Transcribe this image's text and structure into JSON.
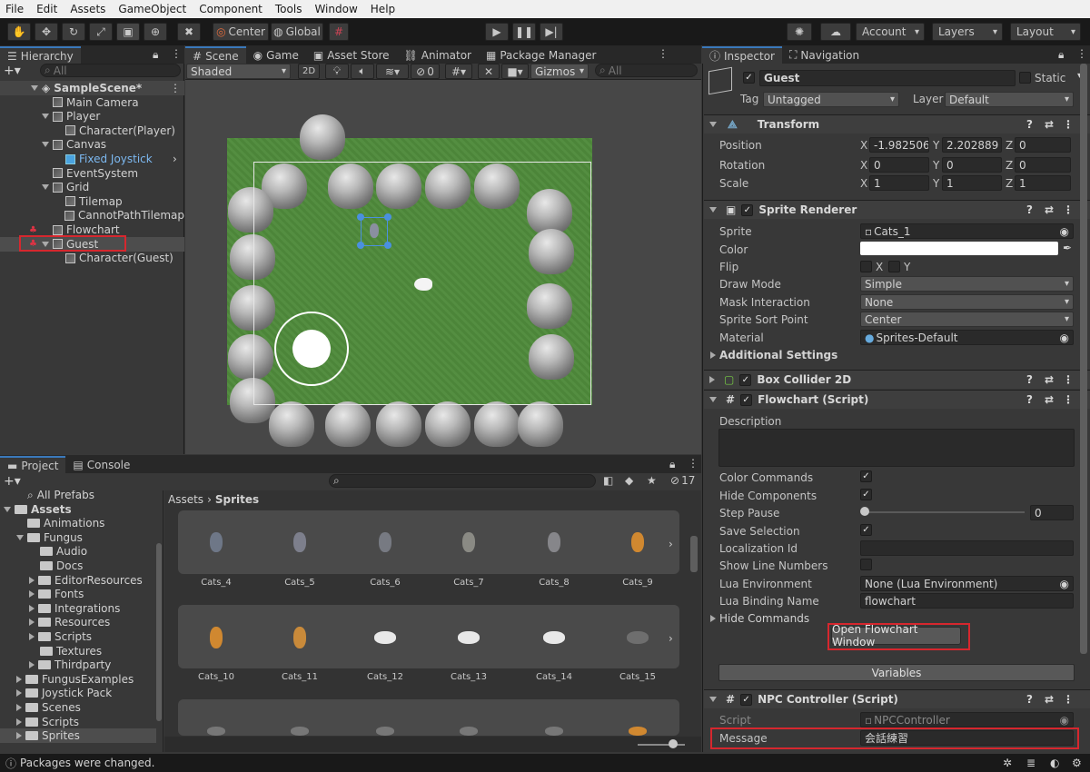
{
  "menu": [
    "File",
    "Edit",
    "Assets",
    "GameObject",
    "Component",
    "Tools",
    "Window",
    "Help"
  ],
  "toolbar": {
    "center": "Center",
    "global": "Global",
    "account": "Account",
    "layers": "Layers",
    "layout": "Layout"
  },
  "hierarchy": {
    "tab": "Hierarchy",
    "search_placeholder": "All",
    "items": [
      {
        "label": "SampleScene*",
        "depth": 0
      },
      {
        "label": "Main Camera",
        "depth": 1
      },
      {
        "label": "Player",
        "depth": 1
      },
      {
        "label": "Character(Player)",
        "depth": 2
      },
      {
        "label": "Canvas",
        "depth": 1
      },
      {
        "label": "Fixed Joystick",
        "depth": 2
      },
      {
        "label": "EventSystem",
        "depth": 1
      },
      {
        "label": "Grid",
        "depth": 1
      },
      {
        "label": "Tilemap",
        "depth": 2
      },
      {
        "label": "CannotPathTilemap",
        "depth": 2
      },
      {
        "label": "Flowchart",
        "depth": 1
      },
      {
        "label": "Guest",
        "depth": 1
      },
      {
        "label": "Character(Guest)",
        "depth": 2
      }
    ]
  },
  "scene": {
    "tabs": [
      "Scene",
      "Game",
      "Asset Store",
      "Animator",
      "Package Manager"
    ],
    "shading": "Shaded",
    "mode2d": "2D",
    "gizmos": "Gizmos",
    "hidden_count": "0",
    "search_placeholder": "All"
  },
  "project": {
    "tabs": [
      "Project",
      "Console"
    ],
    "breadcrumb": [
      "Assets",
      "Sprites"
    ],
    "hidden_count": "17",
    "tree": [
      {
        "label": "All Prefabs",
        "depth": 1
      },
      {
        "label": "Assets",
        "depth": 0
      },
      {
        "label": "Animations",
        "depth": 1
      },
      {
        "label": "Fungus",
        "depth": 1
      },
      {
        "label": "Audio",
        "depth": 2
      },
      {
        "label": "Docs",
        "depth": 2
      },
      {
        "label": "EditorResources",
        "depth": 2
      },
      {
        "label": "Fonts",
        "depth": 2
      },
      {
        "label": "Integrations",
        "depth": 2
      },
      {
        "label": "Resources",
        "depth": 2
      },
      {
        "label": "Scripts",
        "depth": 2
      },
      {
        "label": "Textures",
        "depth": 2
      },
      {
        "label": "Thirdparty",
        "depth": 2
      },
      {
        "label": "FungusExamples",
        "depth": 1
      },
      {
        "label": "Joystick Pack",
        "depth": 1
      },
      {
        "label": "Scenes",
        "depth": 1
      },
      {
        "label": "Scripts",
        "depth": 1
      },
      {
        "label": "Sprites",
        "depth": 1
      }
    ],
    "assets_row1": [
      "Cats_4",
      "Cats_5",
      "Cats_6",
      "Cats_7",
      "Cats_8",
      "Cats_9"
    ],
    "assets_row2": [
      "Cats_10",
      "Cats_11",
      "Cats_12",
      "Cats_13",
      "Cats_14",
      "Cats_15"
    ]
  },
  "status": "Packages were changed.",
  "inspector": {
    "tabs": [
      "Inspector",
      "Navigation"
    ],
    "object_name": "Guest",
    "static_label": "Static",
    "tag_label": "Tag",
    "tag_value": "Untagged",
    "layer_label": "Layer",
    "layer_value": "Default",
    "transform": {
      "title": "Transform",
      "position_label": "Position",
      "rotation_label": "Rotation",
      "scale_label": "Scale",
      "position": [
        "-1.982506",
        "2.202889",
        "0"
      ],
      "rotation": [
        "0",
        "0",
        "0"
      ],
      "scale": [
        "1",
        "1",
        "1"
      ]
    },
    "sprite_renderer": {
      "title": "Sprite Renderer",
      "sprite_label": "Sprite",
      "sprite": "Cats_1",
      "color_label": "Color",
      "flip_label": "Flip",
      "flip_x": "X",
      "flip_y": "Y",
      "draw_mode_label": "Draw Mode",
      "draw_mode": "Simple",
      "mask_label": "Mask Interaction",
      "mask": "None",
      "sort_label": "Sprite Sort Point",
      "sort": "Center",
      "material_label": "Material",
      "material": "Sprites-Default",
      "additional": "Additional Settings"
    },
    "box_collider": {
      "title": "Box Collider 2D"
    },
    "flowchart": {
      "title": "Flowchart (Script)",
      "description_label": "Description",
      "color_commands": "Color Commands",
      "hide_components": "Hide Components",
      "step_pause": "Step Pause",
      "step_pause_value": "0",
      "save_selection": "Save Selection",
      "localization": "Localization Id",
      "show_line_numbers": "Show Line Numbers",
      "lua_env_label": "Lua Environment",
      "lua_env": "None (Lua Environment)",
      "lua_binding_label": "Lua Binding Name",
      "lua_binding": "flowchart",
      "hide_commands": "Hide Commands",
      "open_button": "Open Flowchart Window",
      "variables": "Variables"
    },
    "npc": {
      "title": "NPC Controller (Script)",
      "script_label": "Script",
      "script": "NPCController",
      "message_label": "Message",
      "message": "会話練習"
    }
  },
  "colors": {
    "accent": "#3a79bb",
    "highlight": "#d6272e",
    "grass": "#4a8a3a",
    "selected": "#4d4d4d"
  }
}
